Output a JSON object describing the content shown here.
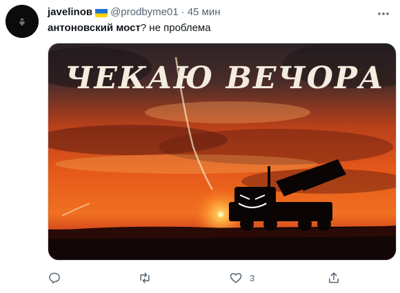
{
  "author": {
    "name": "javelinов",
    "handle": "@prodbyme01",
    "separator": "·",
    "time": "45 мин"
  },
  "tweet": {
    "text_bold": "антоновский мост",
    "text_rest": "? не проблема"
  },
  "media": {
    "title": "ЧЕКАЮ ВЕЧОРА"
  },
  "actions": {
    "like_count": "3"
  },
  "icons": {
    "flag": "ukraine-flag-icon",
    "more": "more-dots-icon",
    "reply": "reply-icon",
    "retweet": "retweet-icon",
    "like": "heart-icon",
    "share": "share-icon"
  },
  "colors": {
    "secondary_text": "#536471",
    "flag_blue": "#1f6fd6",
    "flag_yellow": "#ffd500"
  }
}
